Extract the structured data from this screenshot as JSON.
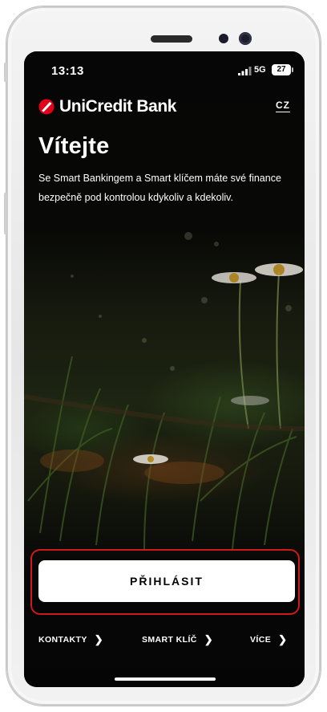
{
  "status_bar": {
    "time": "13:13",
    "network": "5G",
    "battery": "27"
  },
  "brand": {
    "name": "UniCredit Bank",
    "logo_icon": "unicredit-logo-icon",
    "color": "#e2001a"
  },
  "language_toggle": "CZ",
  "welcome": {
    "title": "Vítejte",
    "subtitle": "Se Smart Bankingem a Smart klíčem máte své finance bezpečně pod kontrolou kdykoliv a kdekoliv."
  },
  "login_button": "PŘIHLÁSIT",
  "highlight_color": "#d01a1a",
  "bottom_nav": [
    {
      "label": "KONTAKTY",
      "icon": "chevron-right-icon"
    },
    {
      "label": "SMART KLÍČ",
      "icon": "chevron-right-icon"
    },
    {
      "label": "VÍCE",
      "icon": "chevron-right-icon"
    }
  ]
}
